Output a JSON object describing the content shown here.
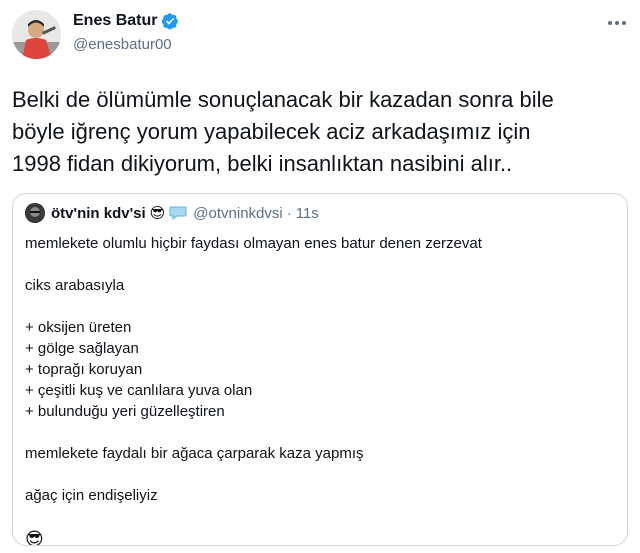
{
  "author": {
    "display_name": "Enes Batur",
    "handle": "@enesbatur00",
    "verified_icon": "verified-badge-icon",
    "more_icon": "more-options-icon"
  },
  "tweet_text": "Belki de ölümümle sonuçlanacak bir kazadan sonra bile\nböyle iğrenç yorum yapabilecek aciz arkadaşımız için\n1998 fidan dikiyorum, belki insanlıktan nasibini alır..",
  "quoted": {
    "display_name": "ötv'nin kdv'si",
    "name_emoji": "😎",
    "badge_icon": "speech-bubble-icon",
    "handle": "@otvninkdvsi",
    "separator": "·",
    "time": "11s",
    "lines": {
      "l1": "memlekete olumlu hiçbir faydası olmayan enes batur denen zerzevat",
      "l2": "ciks arabasıyla",
      "l3": "+ oksijen üreten",
      "l4": "+ gölge sağlayan",
      "l5": "+ toprağı koruyan",
      "l6": "+ çeşitli kuş ve canlılara yuva olan",
      "l7": "+ bulunduğu yeri güzelleştiren",
      "l8": "memlekete faydalı bir ağaca çarparak kaza yapmış",
      "l9": "ağaç için endişeliyiz",
      "l10": "😎"
    }
  },
  "colors": {
    "text": "#0f1419",
    "secondary": "#5b7083",
    "verified": "#1d9bf0",
    "border": "#cfd9de"
  }
}
